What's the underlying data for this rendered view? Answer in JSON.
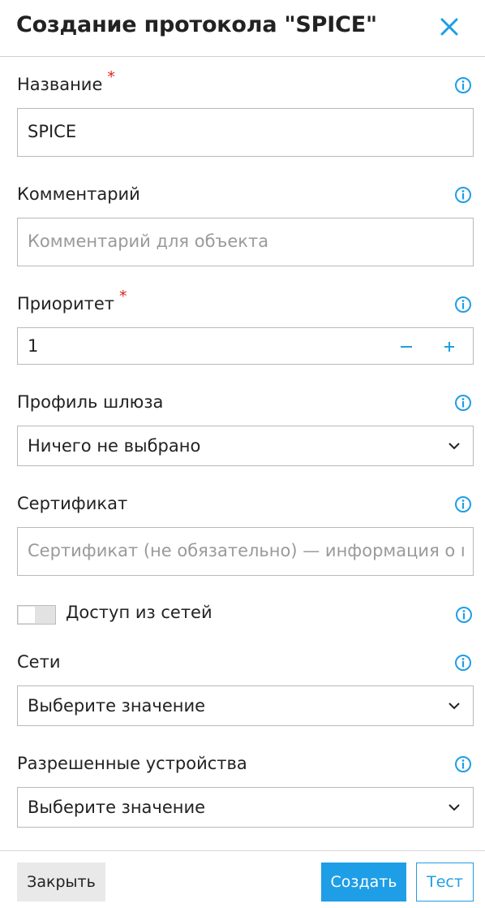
{
  "dialog": {
    "title": "Создание протокола \"SPICE\""
  },
  "colors": {
    "accent": "#1e9ee6",
    "required": "#e0201a"
  },
  "form": {
    "name": {
      "label": "Название",
      "required_mark": "*",
      "value": "SPICE"
    },
    "comment": {
      "label": "Комментарий",
      "placeholder": "Комментарий для объекта"
    },
    "priority": {
      "label": "Приоритет",
      "required_mark": "*",
      "value": "1",
      "decrement_icon": "minus-icon",
      "increment_icon": "plus-icon"
    },
    "gateway_profile": {
      "label": "Профиль шлюза",
      "selected": "Ничего не выбрано"
    },
    "certificate": {
      "label": "Сертификат",
      "placeholder": "Сертификат (не обязательно) — информация о г"
    },
    "network_access": {
      "label": "Доступ из сетей",
      "enabled": false
    },
    "networks": {
      "label": "Сети",
      "selected": "Выберите значение"
    },
    "allowed_devices": {
      "label": "Разрешенные устройства",
      "selected": "Выберите значение"
    }
  },
  "footer": {
    "close_label": "Закрыть",
    "create_label": "Создать",
    "test_label": "Тест"
  }
}
